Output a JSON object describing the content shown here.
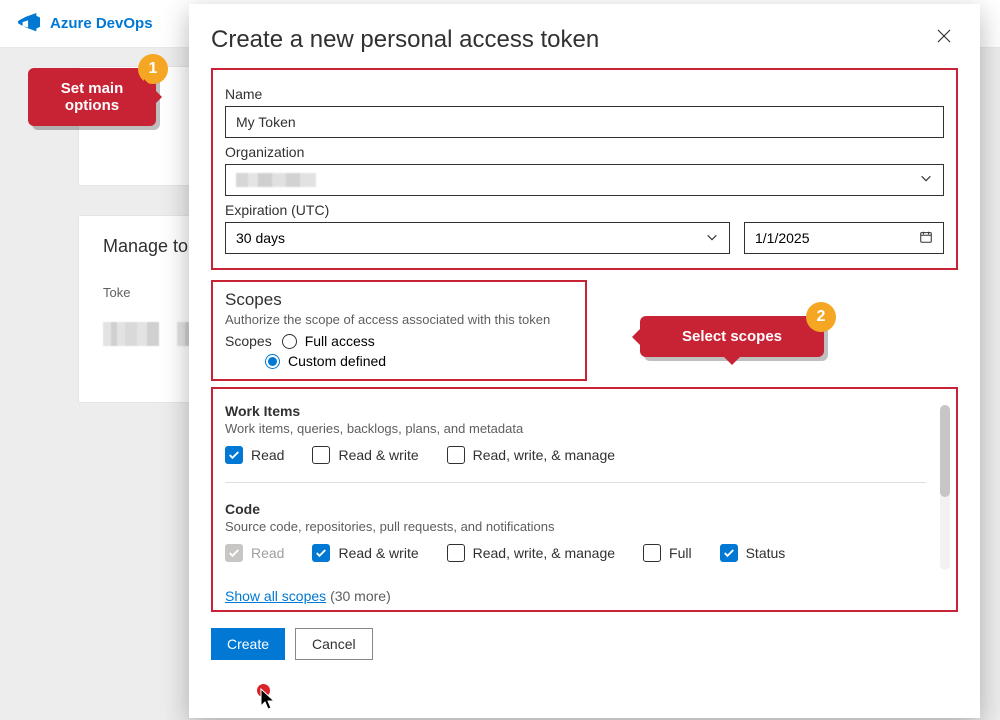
{
  "app": {
    "name": "Azure DevOps"
  },
  "background": {
    "manage_tokens_title": "Manage tok",
    "token_col": "Toke"
  },
  "callouts": {
    "c1": {
      "num": "1",
      "text": "Set main options"
    },
    "c2": {
      "num": "2",
      "text": "Select scopes"
    }
  },
  "modal": {
    "title": "Create a new personal access token",
    "name_label": "Name",
    "name_value": "My Token",
    "org_label": "Organization",
    "expiration_label": "Expiration (UTC)",
    "expiration_select": "30 days",
    "expiration_date": "1/1/2025"
  },
  "scopes_header": {
    "title": "Scopes",
    "subtitle": "Authorize the scope of access associated with this token",
    "label": "Scopes",
    "opt_full": "Full access",
    "opt_custom": "Custom defined",
    "selected": "custom"
  },
  "scope_groups": [
    {
      "title": "Work Items",
      "desc": "Work items, queries, backlogs, plans, and metadata",
      "options": [
        {
          "label": "Read",
          "checked": true,
          "disabled": false
        },
        {
          "label": "Read & write",
          "checked": false,
          "disabled": false
        },
        {
          "label": "Read, write, & manage",
          "checked": false,
          "disabled": false
        }
      ]
    },
    {
      "title": "Code",
      "desc": "Source code, repositories, pull requests, and notifications",
      "options": [
        {
          "label": "Read",
          "checked": true,
          "disabled": true
        },
        {
          "label": "Read & write",
          "checked": true,
          "disabled": false
        },
        {
          "label": "Read, write, & manage",
          "checked": false,
          "disabled": false
        },
        {
          "label": "Full",
          "checked": false,
          "disabled": false
        },
        {
          "label": "Status",
          "checked": true,
          "disabled": false
        }
      ]
    }
  ],
  "show_all": {
    "link": "Show all scopes",
    "more": "(30 more)"
  },
  "buttons": {
    "create": "Create",
    "cancel": "Cancel"
  }
}
